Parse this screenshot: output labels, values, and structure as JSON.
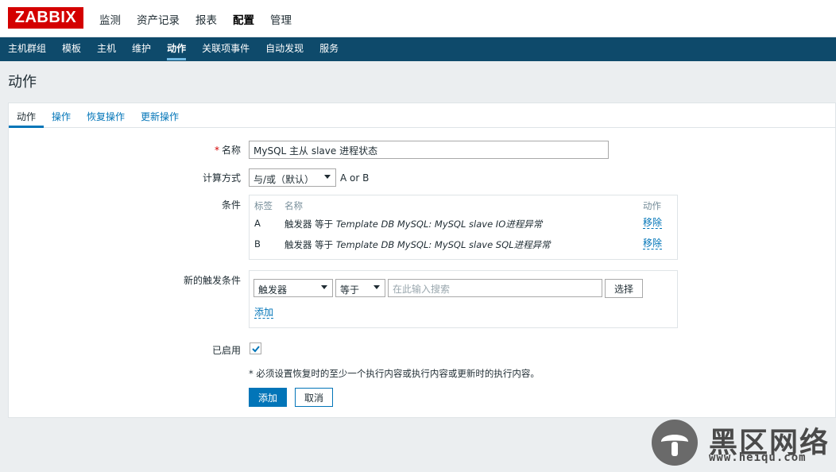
{
  "header": {
    "logo": "ZABBIX",
    "menu": [
      "监测",
      "资产记录",
      "报表",
      "配置",
      "管理"
    ],
    "active_menu": "配置"
  },
  "subnav": {
    "items": [
      "主机群组",
      "模板",
      "主机",
      "维护",
      "动作",
      "关联项事件",
      "自动发现",
      "服务"
    ],
    "active": "动作"
  },
  "page": {
    "title": "动作"
  },
  "tabs": [
    "动作",
    "操作",
    "恢复操作",
    "更新操作"
  ],
  "form": {
    "name_label": "名称",
    "name_required_mark": "*",
    "name_value": "MySQL 主从 slave 进程状态",
    "calc_label": "计算方式",
    "calc_value": "与/或（默认）",
    "calc_expression": "A or B",
    "conditions_label": "条件",
    "conditions_headers": {
      "tag": "标签",
      "name": "名称",
      "action": "动作"
    },
    "conditions": [
      {
        "tag": "A",
        "prefix": "触发器 等于 ",
        "value": "Template DB MySQL: MySQL slave IO进程异常",
        "action": "移除"
      },
      {
        "tag": "B",
        "prefix": "触发器 等于 ",
        "value": "Template DB MySQL: MySQL slave SQL进程异常",
        "action": "移除"
      }
    ],
    "new_condition_label": "新的触发条件",
    "new_condition_type": "触发器",
    "new_condition_operator": "等于",
    "new_condition_placeholder": "在此输入搜索",
    "select_button": "选择",
    "add_link": "添加",
    "enabled_label": "已启用",
    "enabled": true,
    "note": "* 必须设置恢复时的至少一个执行内容或执行内容或更新时的执行内容。",
    "submit_button": "添加",
    "cancel_button": "取消"
  },
  "watermark": {
    "text": "黑区网络",
    "url": "www.heiqu.com"
  },
  "colors": {
    "brand_red": "#d40000",
    "nav_dark": "#0e4a6b",
    "accent_blue": "#0275b8"
  }
}
